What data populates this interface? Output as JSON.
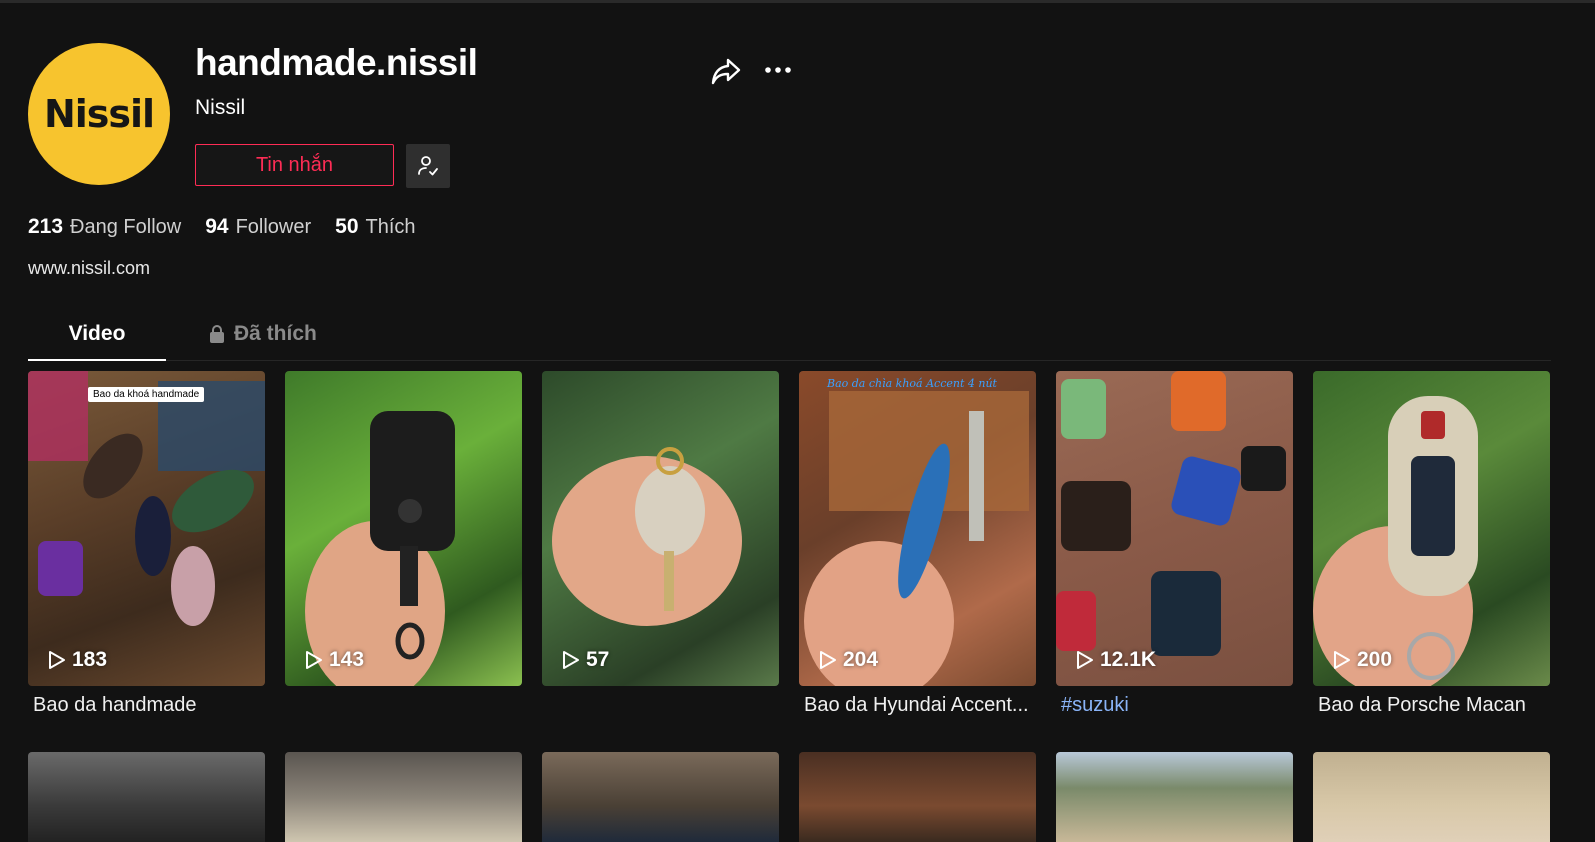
{
  "profile": {
    "username": "handmade.nissil",
    "nickname": "Nissil",
    "avatar_text": "Nissil",
    "message_button": "Tin nhắn",
    "website": "www.nissil.com"
  },
  "stats": [
    {
      "value": "213",
      "label": "Đang Follow"
    },
    {
      "value": "94",
      "label": "Follower"
    },
    {
      "value": "50",
      "label": "Thích"
    }
  ],
  "tabs": [
    {
      "label": "Video",
      "active": true
    },
    {
      "label": "Đã thích",
      "locked": true
    }
  ],
  "icons": {
    "share": "share-icon",
    "more": "more-icon",
    "follow": "user-check-icon",
    "lock": "lock-icon",
    "play": "play-icon"
  },
  "videos": [
    {
      "views": "183",
      "caption": "Bao da handmade",
      "overlay": "Bao da khoá handmade"
    },
    {
      "views": "143",
      "caption": ""
    },
    {
      "views": "57",
      "caption": ""
    },
    {
      "views": "204",
      "caption": "Bao da Hyundai Accent...",
      "overlay": "Bao da chìa khoá Accent 4 nút"
    },
    {
      "views": "12.1K",
      "caption": "#suzuki"
    },
    {
      "views": "200",
      "caption": "Bao da Porsche Macan"
    }
  ],
  "colors": {
    "background": "#121212",
    "accent": "#FE2C55",
    "avatar": "#F7C42E",
    "hashtag": "#8ab4f8"
  }
}
